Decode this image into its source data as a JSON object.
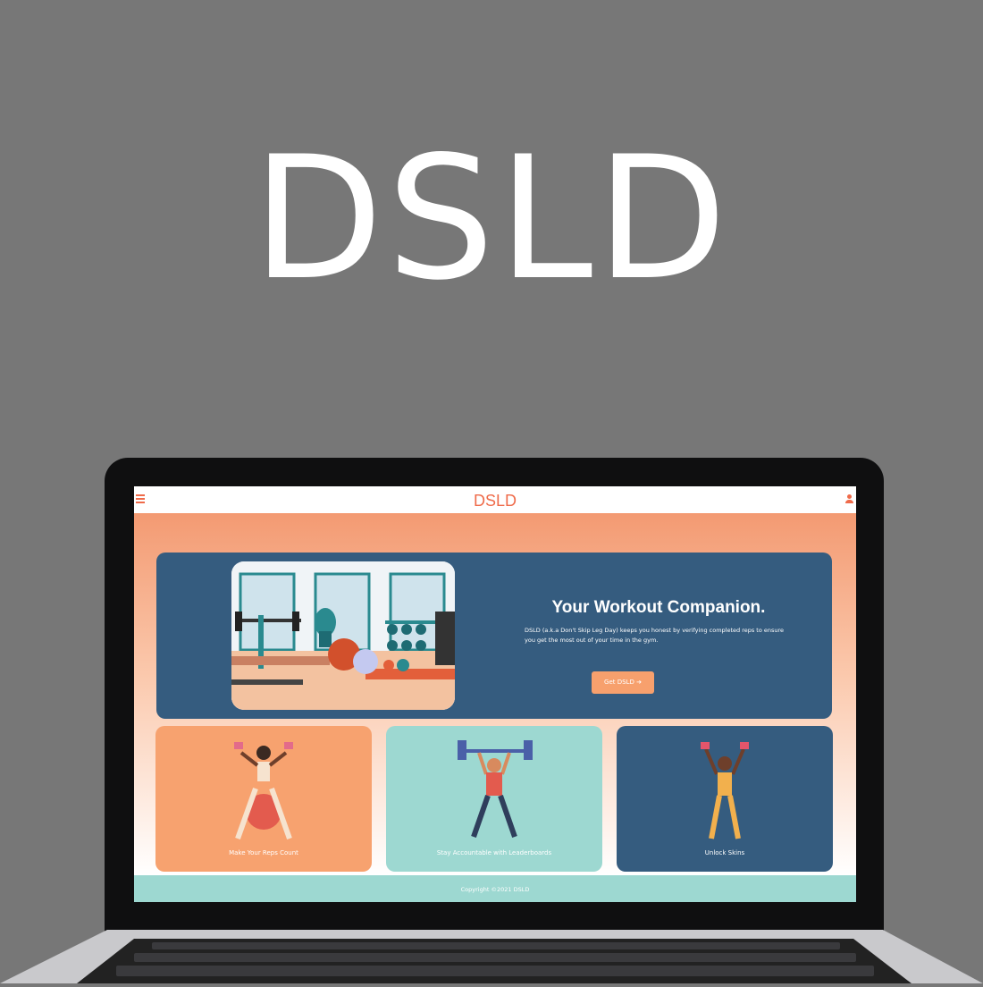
{
  "title": "DSLD",
  "site": {
    "brand": "DSLD",
    "hero": {
      "title": "Your Workout Companion.",
      "description": "DSLD (a.k.a Don't Skip Leg Day) keeps you honest by verifying completed reps to ensure you get the most out of your time in the gym.",
      "button_label": "Get DSLD",
      "button_arrow": "➔"
    },
    "features": [
      {
        "label": "Make Your Reps Count",
        "color": "#f7a26f"
      },
      {
        "label": "Stay Accountable with Leaderboards",
        "color": "#9dd8d1"
      },
      {
        "label": "Unlock Skins",
        "color": "#355c7f"
      }
    ],
    "footer": "Copyright ©2021 DSLD"
  },
  "colors": {
    "background": "#777777",
    "accent": "#ef6b4a",
    "navy": "#355c7f",
    "teal": "#9dd8d1",
    "orange": "#f7a26f"
  },
  "icons": [
    "menu-icon",
    "user-icon",
    "arrow-right-icon"
  ]
}
